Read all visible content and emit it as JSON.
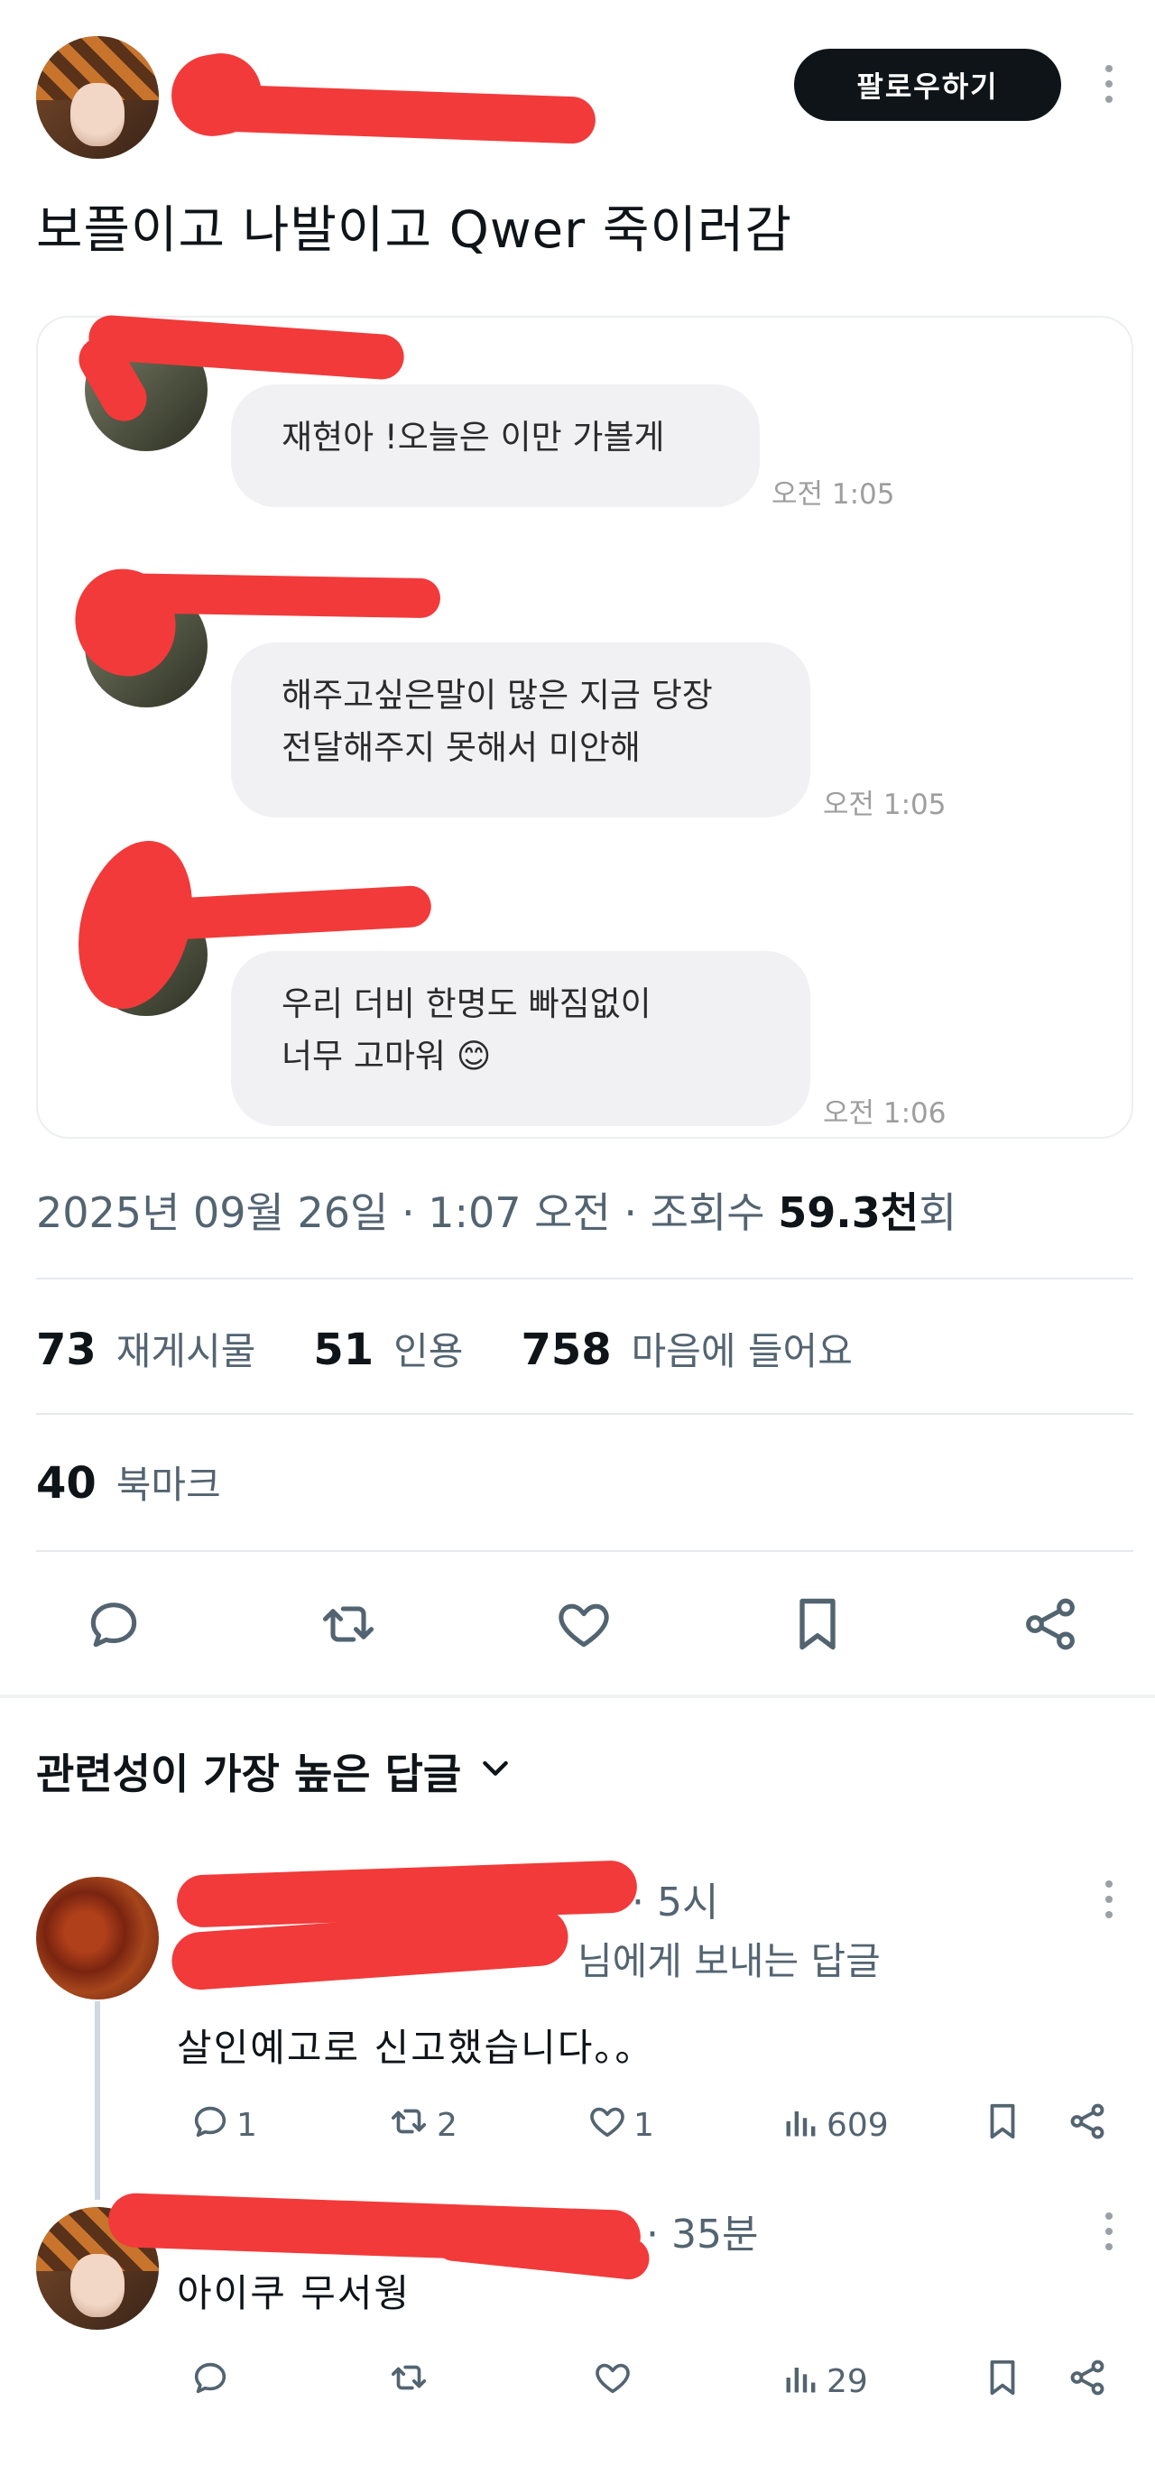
{
  "post": {
    "follow_label": "팔로우하기",
    "text": "보플이고 나발이고 Qwer 죽이러감",
    "timestamp": "2025년 09월 26일 · 1:07 오전 · 조회수 ",
    "views": "59.3천",
    "views_suffix": "회",
    "stats": {
      "reposts": "73",
      "reposts_label": "재게시물",
      "quotes": "51",
      "quotes_label": "인용",
      "likes": "758",
      "likes_label": "마음에 들어요",
      "bookmarks": "40",
      "bookmarks_label": "북마크"
    }
  },
  "chat": {
    "messages": [
      {
        "lines": [
          "재현아 !오늘은 이만 가볼게"
        ],
        "time": "오전 1:05"
      },
      {
        "lines": [
          "해주고싶은말이 많은 지금 당장",
          "전달해주지 못해서 미안해"
        ],
        "time": "오전 1:05"
      },
      {
        "lines": [
          "우리 더비 한명도 빠짐없이",
          "너무 고마워 😊"
        ],
        "time": "오전 1:06"
      }
    ]
  },
  "replies_header": "관련성이 가장 높은 답글",
  "replies": [
    {
      "time": "· 5시",
      "reply_to": "님에게 보내는 답글",
      "text": "살인예고로 신고했습니다。。",
      "comments": "1",
      "reposts": "2",
      "likes": "1",
      "views": "609"
    },
    {
      "time": "· 35분",
      "text": "아이쿠 무서웡",
      "comments": "",
      "reposts": "",
      "likes": "",
      "views": "29"
    }
  ],
  "icons": [
    "reply-icon",
    "repost-icon",
    "like-icon",
    "bookmark-icon",
    "share-icon",
    "views-icon",
    "more-icon",
    "chevron-down-icon"
  ],
  "colors": {
    "text": "#0f1419",
    "secondary": "#536471",
    "bubble": "#f1f1f3",
    "redaction": "#f23a3a",
    "button": "#0f1419"
  }
}
